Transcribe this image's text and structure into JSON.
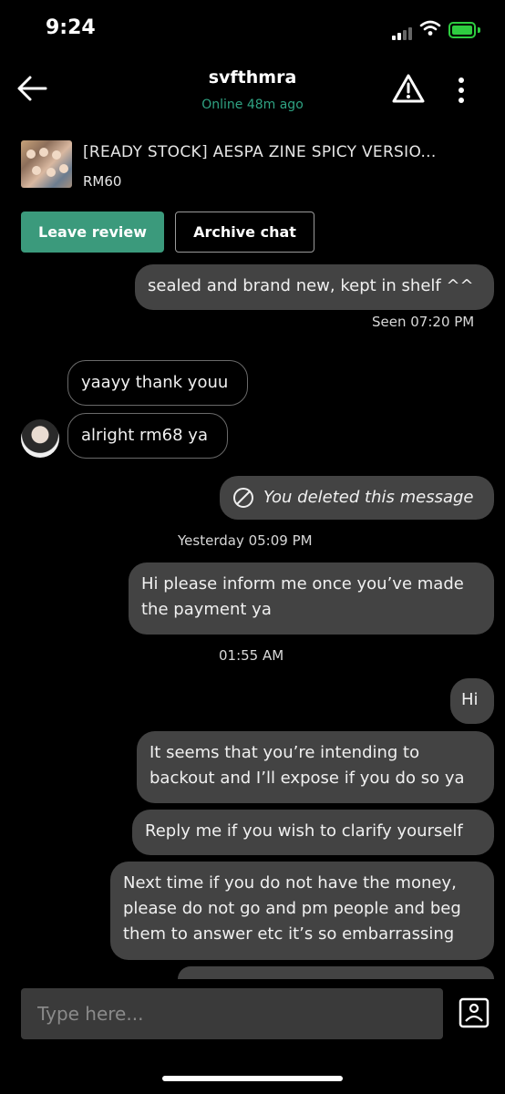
{
  "status": {
    "time": "9:24"
  },
  "header": {
    "username": "svfthmra",
    "presence": "Online 48m ago"
  },
  "product": {
    "title": "[READY STOCK] AESPA ZINE SPICY VERSIO...",
    "price": "RM60"
  },
  "actions": {
    "leave_review": "Leave review",
    "archive_chat": "Archive chat"
  },
  "messages": [
    {
      "text": "sealed and brand new, kept in shelf ^^"
    },
    {
      "text": "Seen 07:20 PM"
    },
    {
      "text": "yaayy thank youu"
    },
    {
      "text": "alright rm68 ya"
    },
    {
      "text": "You deleted this message"
    },
    {
      "text": "Yesterday 05:09 PM"
    },
    {
      "text": "Hi please inform me once you’ve made the payment ya"
    },
    {
      "text": "01:55 AM"
    },
    {
      "text": "Hi"
    },
    {
      "text": "It seems that you’re intending to backout and I’ll expose if you do so ya"
    },
    {
      "text": "Reply me if you wish to clarify yourself"
    },
    {
      "text": "Next time if you do not have the money, please do not go and pm people and beg them to answer etc it’s so embarrassing"
    }
  ],
  "composer": {
    "placeholder": "Type here..."
  },
  "colors": {
    "accent": "#3b9a7c",
    "online": "#2fa383",
    "outgoing_bubble": "#434343"
  }
}
